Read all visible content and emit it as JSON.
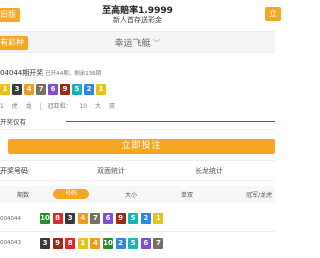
{
  "header": {
    "back_label": "旧版",
    "title": "至高赔率1.9999",
    "subtitle": "新人首存送彩金",
    "download_label": "立"
  },
  "lottery_bar": {
    "more_label": "有彩种",
    "lottery_name": "幸运飞艇",
    "chevron": "﹀"
  },
  "issue": {
    "label": "04044期开奖",
    "progress_text": "已开44期，剩余136期",
    "balls": [
      {
        "n": "1",
        "color": "#e9c318"
      },
      {
        "n": "3",
        "color": "#3b3b3b"
      },
      {
        "n": "4",
        "color": "#f39a1f"
      },
      {
        "n": "7",
        "color": "#7a6f63"
      },
      {
        "n": "6",
        "color": "#7b4fd0"
      },
      {
        "n": "9",
        "color": "#9a2a1a"
      },
      {
        "n": "5",
        "color": "#19b3bb"
      },
      {
        "n": "2",
        "color": "#2f86e4"
      },
      {
        "n": "1",
        "color": "#e9c318"
      }
    ],
    "stats": {
      "a": "1",
      "b": "虎",
      "c": "龙",
      "champion_label": "冠亚和：",
      "sum": "10",
      "size": "大",
      "parity": "双"
    }
  },
  "ticker": {
    "label": "开奖仅有"
  },
  "bet_button": "立即投注",
  "tabs": [
    {
      "label": "开奖号码",
      "active": true
    },
    {
      "label": "双面统计",
      "active": false
    },
    {
      "label": "长龙统计",
      "active": false
    }
  ],
  "filters": [
    {
      "label": "期数",
      "active": false
    },
    {
      "label": "号码",
      "active": true
    },
    {
      "label": "大小",
      "active": false
    },
    {
      "label": "单双",
      "active": false
    },
    {
      "label": "冠军/龙虎",
      "active": false
    }
  ],
  "history": [
    {
      "issue": "004044",
      "balls": [
        {
          "n": "10",
          "color": "#2a8c2a"
        },
        {
          "n": "8",
          "color": "#e02828"
        },
        {
          "n": "3",
          "color": "#3b3b3b"
        },
        {
          "n": "4",
          "color": "#f39a1f"
        },
        {
          "n": "7",
          "color": "#7a6f63"
        },
        {
          "n": "6",
          "color": "#7b4fd0"
        },
        {
          "n": "9",
          "color": "#9a2a1a"
        },
        {
          "n": "5",
          "color": "#19b3bb"
        },
        {
          "n": "2",
          "color": "#2f86e4"
        },
        {
          "n": "1",
          "color": "#e9c318"
        }
      ]
    },
    {
      "issue": "004043",
      "balls": [
        {
          "n": "3",
          "color": "#3b3b3b"
        },
        {
          "n": "9",
          "color": "#9a2a1a"
        },
        {
          "n": "8",
          "color": "#e02828"
        },
        {
          "n": "1",
          "color": "#e9c318"
        },
        {
          "n": "4",
          "color": "#f39a1f"
        },
        {
          "n": "10",
          "color": "#2a8c2a"
        },
        {
          "n": "2",
          "color": "#2f86e4"
        },
        {
          "n": "5",
          "color": "#19b3bb"
        },
        {
          "n": "6",
          "color": "#7b4fd0"
        },
        {
          "n": "7",
          "color": "#7a6f63"
        }
      ]
    }
  ]
}
